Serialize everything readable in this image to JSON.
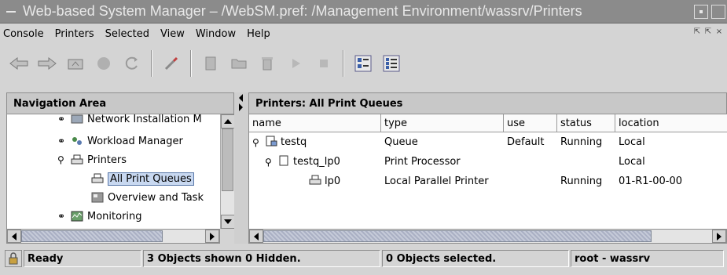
{
  "window": {
    "title": "Web-based System Manager – /WebSM.pref: /Management Environment/wassrv/Printers"
  },
  "menubar": {
    "items": [
      "Console",
      "Printers",
      "Selected",
      "View",
      "Window",
      "Help"
    ]
  },
  "toolbar": {
    "buttons": [
      "back-arrow-icon",
      "forward-arrow-icon",
      "up-folder-icon",
      "stop-icon",
      "refresh-icon",
      "find-icon",
      "properties-icon",
      "open-icon",
      "delete-icon",
      "run-icon",
      "stop-queue-icon",
      "large-icons-icon",
      "details-view-icon"
    ]
  },
  "navigation": {
    "header": "Navigation Area",
    "tree": [
      {
        "label": "Network Installation M",
        "icon": "network-install-icon",
        "expander": "collapsed"
      },
      {
        "label": "Workload Manager",
        "icon": "workload-icon",
        "expander": "collapsed"
      },
      {
        "label": "Printers",
        "icon": "printer-icon",
        "expander": "expanded"
      },
      {
        "label": "All Print Queues",
        "icon": "printer-icon",
        "selected": true
      },
      {
        "label": "Overview and Task",
        "icon": "overview-icon"
      },
      {
        "label": "Monitoring",
        "icon": "monitoring-icon",
        "expander": "collapsed"
      }
    ]
  },
  "main": {
    "header": "Printers: All Print Queues",
    "columns": [
      "name",
      "type",
      "use",
      "status",
      "location"
    ],
    "rows": [
      {
        "name": "testq",
        "type": "Queue",
        "use": "Default",
        "status": "Running",
        "location": "Local",
        "icon": "queue-icon"
      },
      {
        "name": "testq_lp0",
        "type": "Print Processor",
        "use": "",
        "status": "",
        "location": "Local",
        "icon": "document-icon"
      },
      {
        "name": "lp0",
        "type": "Local Parallel Printer",
        "use": "",
        "status": "Running",
        "location": "01-R1-00-00",
        "icon": "printer-icon"
      }
    ]
  },
  "status": {
    "state": "Ready",
    "objects_shown": "3 Objects shown 0 Hidden.",
    "objects_selected": "0 Objects selected.",
    "user_host": "root - wassrv"
  },
  "colors": {
    "titlebar": "#8b8b8b",
    "selection": "#c8d8f0",
    "background": "#d4d4d4"
  }
}
